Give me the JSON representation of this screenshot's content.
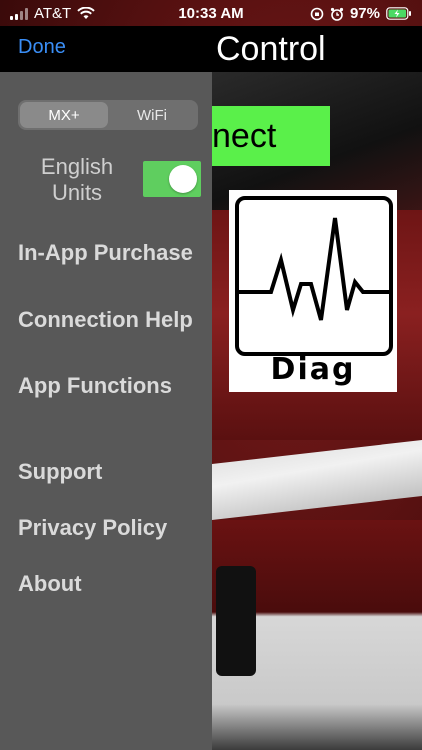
{
  "status_bar": {
    "carrier": "AT&T",
    "time": "10:33 AM",
    "battery": "97%",
    "wifi_icon": "wifi-icon",
    "lock_icon": "orientation-lock-icon",
    "alarm_icon": "alarm-icon"
  },
  "nav": {
    "done_label": "Done",
    "title": "Control"
  },
  "drawer": {
    "segment_options": [
      "MX+",
      "WiFi"
    ],
    "selected_segment": "MX+",
    "units_label": "English Units",
    "units_toggle_on": true,
    "menu_items": [
      {
        "label": "In-App Purchase"
      },
      {
        "label": "Connection Help"
      },
      {
        "label": "App Functions"
      },
      {
        "label": "Support"
      },
      {
        "label": "Privacy Policy"
      },
      {
        "label": "About"
      }
    ]
  },
  "main": {
    "connect_label": "nect",
    "logo_text": "Diag"
  },
  "colors": {
    "accent": "#3a8ef6",
    "connect_green": "#5af04a",
    "toggle_green": "#5fce5f",
    "drawer_bg": "#585858"
  }
}
